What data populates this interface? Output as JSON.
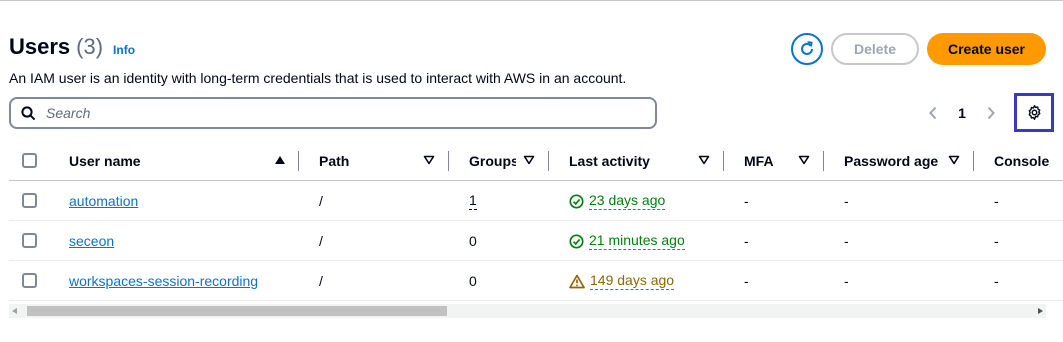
{
  "header": {
    "title": "Users",
    "count": "(3)",
    "info_label": "Info",
    "description": "An IAM user is an identity with long-term credentials that is used to interact with AWS in an account."
  },
  "actions": {
    "refresh_icon": "refresh-icon",
    "delete_label": "Delete",
    "create_label": "Create user"
  },
  "search": {
    "placeholder": "Search",
    "value": ""
  },
  "pagination": {
    "current_page": "1"
  },
  "table": {
    "columns": [
      {
        "label": "User name",
        "sort": "ascending"
      },
      {
        "label": "Path",
        "sort": "none"
      },
      {
        "label": "Groups",
        "sort": "none"
      },
      {
        "label": "Last activity",
        "sort": "none"
      },
      {
        "label": "MFA",
        "sort": "none"
      },
      {
        "label": "Password age",
        "sort": "none"
      },
      {
        "label": "Console"
      }
    ],
    "rows": [
      {
        "user_name": "automation",
        "path": "/",
        "groups": "1",
        "last_activity": "23 days ago",
        "activity_status": "success",
        "mfa": "-",
        "password_age": "-",
        "console": "-"
      },
      {
        "user_name": "seceon",
        "path": "/",
        "groups": "0",
        "last_activity": "21 minutes ago",
        "activity_status": "success",
        "mfa": "-",
        "password_age": "-",
        "console": "-"
      },
      {
        "user_name": "workspaces-session-recording",
        "path": "/",
        "groups": "0",
        "last_activity": "149 days ago",
        "activity_status": "warning",
        "mfa": "-",
        "password_age": "-",
        "console": "-"
      }
    ]
  },
  "colors": {
    "primary_button": "#ff9900",
    "link": "#0972d3",
    "success": "#037f0c",
    "warning": "#8d6605",
    "highlight_border": "#3a3ac0"
  }
}
